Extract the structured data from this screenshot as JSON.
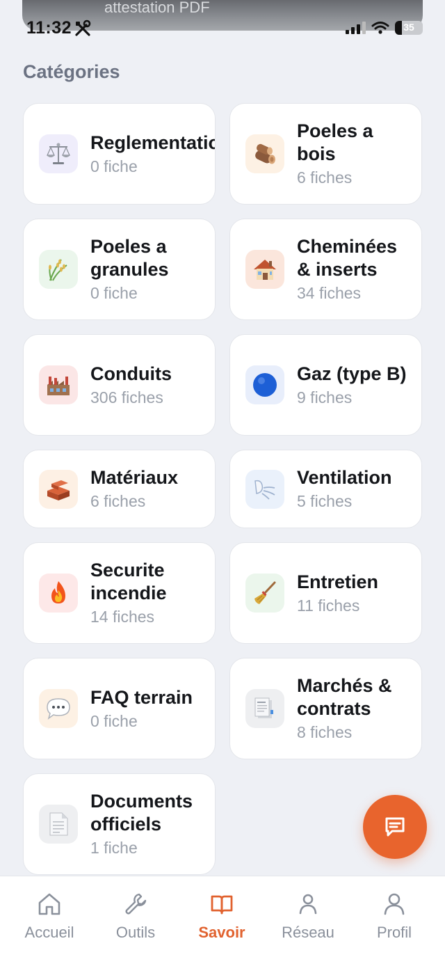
{
  "banner": {
    "text": "attestation PDF"
  },
  "status_bar": {
    "time": "11:32",
    "battery": "35"
  },
  "section_title": "Catégories",
  "categories": [
    {
      "name": "Reglementatio",
      "count": "0 fiche",
      "icon": "scales-icon",
      "tile_color": "#efedfb"
    },
    {
      "name": "Poeles a bois",
      "count": "6 fiches",
      "icon": "wood-log-icon",
      "tile_color": "#fdf1e4"
    },
    {
      "name": "Poeles a granules",
      "count": "0 fiche",
      "icon": "rice-stalk-icon",
      "tile_color": "#ebf6ec"
    },
    {
      "name": "Cheminées & inserts",
      "count": "34 fiches",
      "icon": "house-icon",
      "tile_color": "#fbe6dc"
    },
    {
      "name": "Conduits",
      "count": "306 fiches",
      "icon": "factory-icon",
      "tile_color": "#fbe6e6"
    },
    {
      "name": "Gaz (type B)",
      "count": "9 fiches",
      "icon": "blue-circle-icon",
      "tile_color": "#e8eefb"
    },
    {
      "name": "Matériaux",
      "count": "6 fiches",
      "icon": "bricks-icon",
      "tile_color": "#fdf0e4"
    },
    {
      "name": "Ventilation",
      "count": "5 fiches",
      "icon": "wind-face-icon",
      "tile_color": "#eaf1fb"
    },
    {
      "name": "Securite incendie",
      "count": "14 fiches",
      "icon": "fire-icon",
      "tile_color": "#fde8e8"
    },
    {
      "name": "Entretien",
      "count": "11 fiches",
      "icon": "broom-icon",
      "tile_color": "#ebf6ec"
    },
    {
      "name": "FAQ terrain",
      "count": "0 fiche",
      "icon": "speech-bubble-icon",
      "tile_color": "#fdf1e4"
    },
    {
      "name": "Marchés & contrats",
      "count": "8 fiches",
      "icon": "document-stack-icon",
      "tile_color": "#eeeff1"
    },
    {
      "name": "Documents officiels",
      "count": "1 fiche",
      "icon": "document-icon",
      "tile_color": "#eeeff1"
    }
  ],
  "fab": {
    "icon": "chat-icon",
    "color": "#e8642d"
  },
  "nav": [
    {
      "label": "Accueil",
      "icon": "home-icon"
    },
    {
      "label": "Outils",
      "icon": "wrench-icon"
    },
    {
      "label": "Savoir",
      "icon": "book-icon",
      "active": true
    },
    {
      "label": "Réseau",
      "icon": "network-person-icon"
    },
    {
      "label": "Profil",
      "icon": "profile-icon"
    }
  ],
  "colors": {
    "accent": "#e1622f",
    "background": "#eef0f5",
    "muted": "#9aa0aa"
  }
}
